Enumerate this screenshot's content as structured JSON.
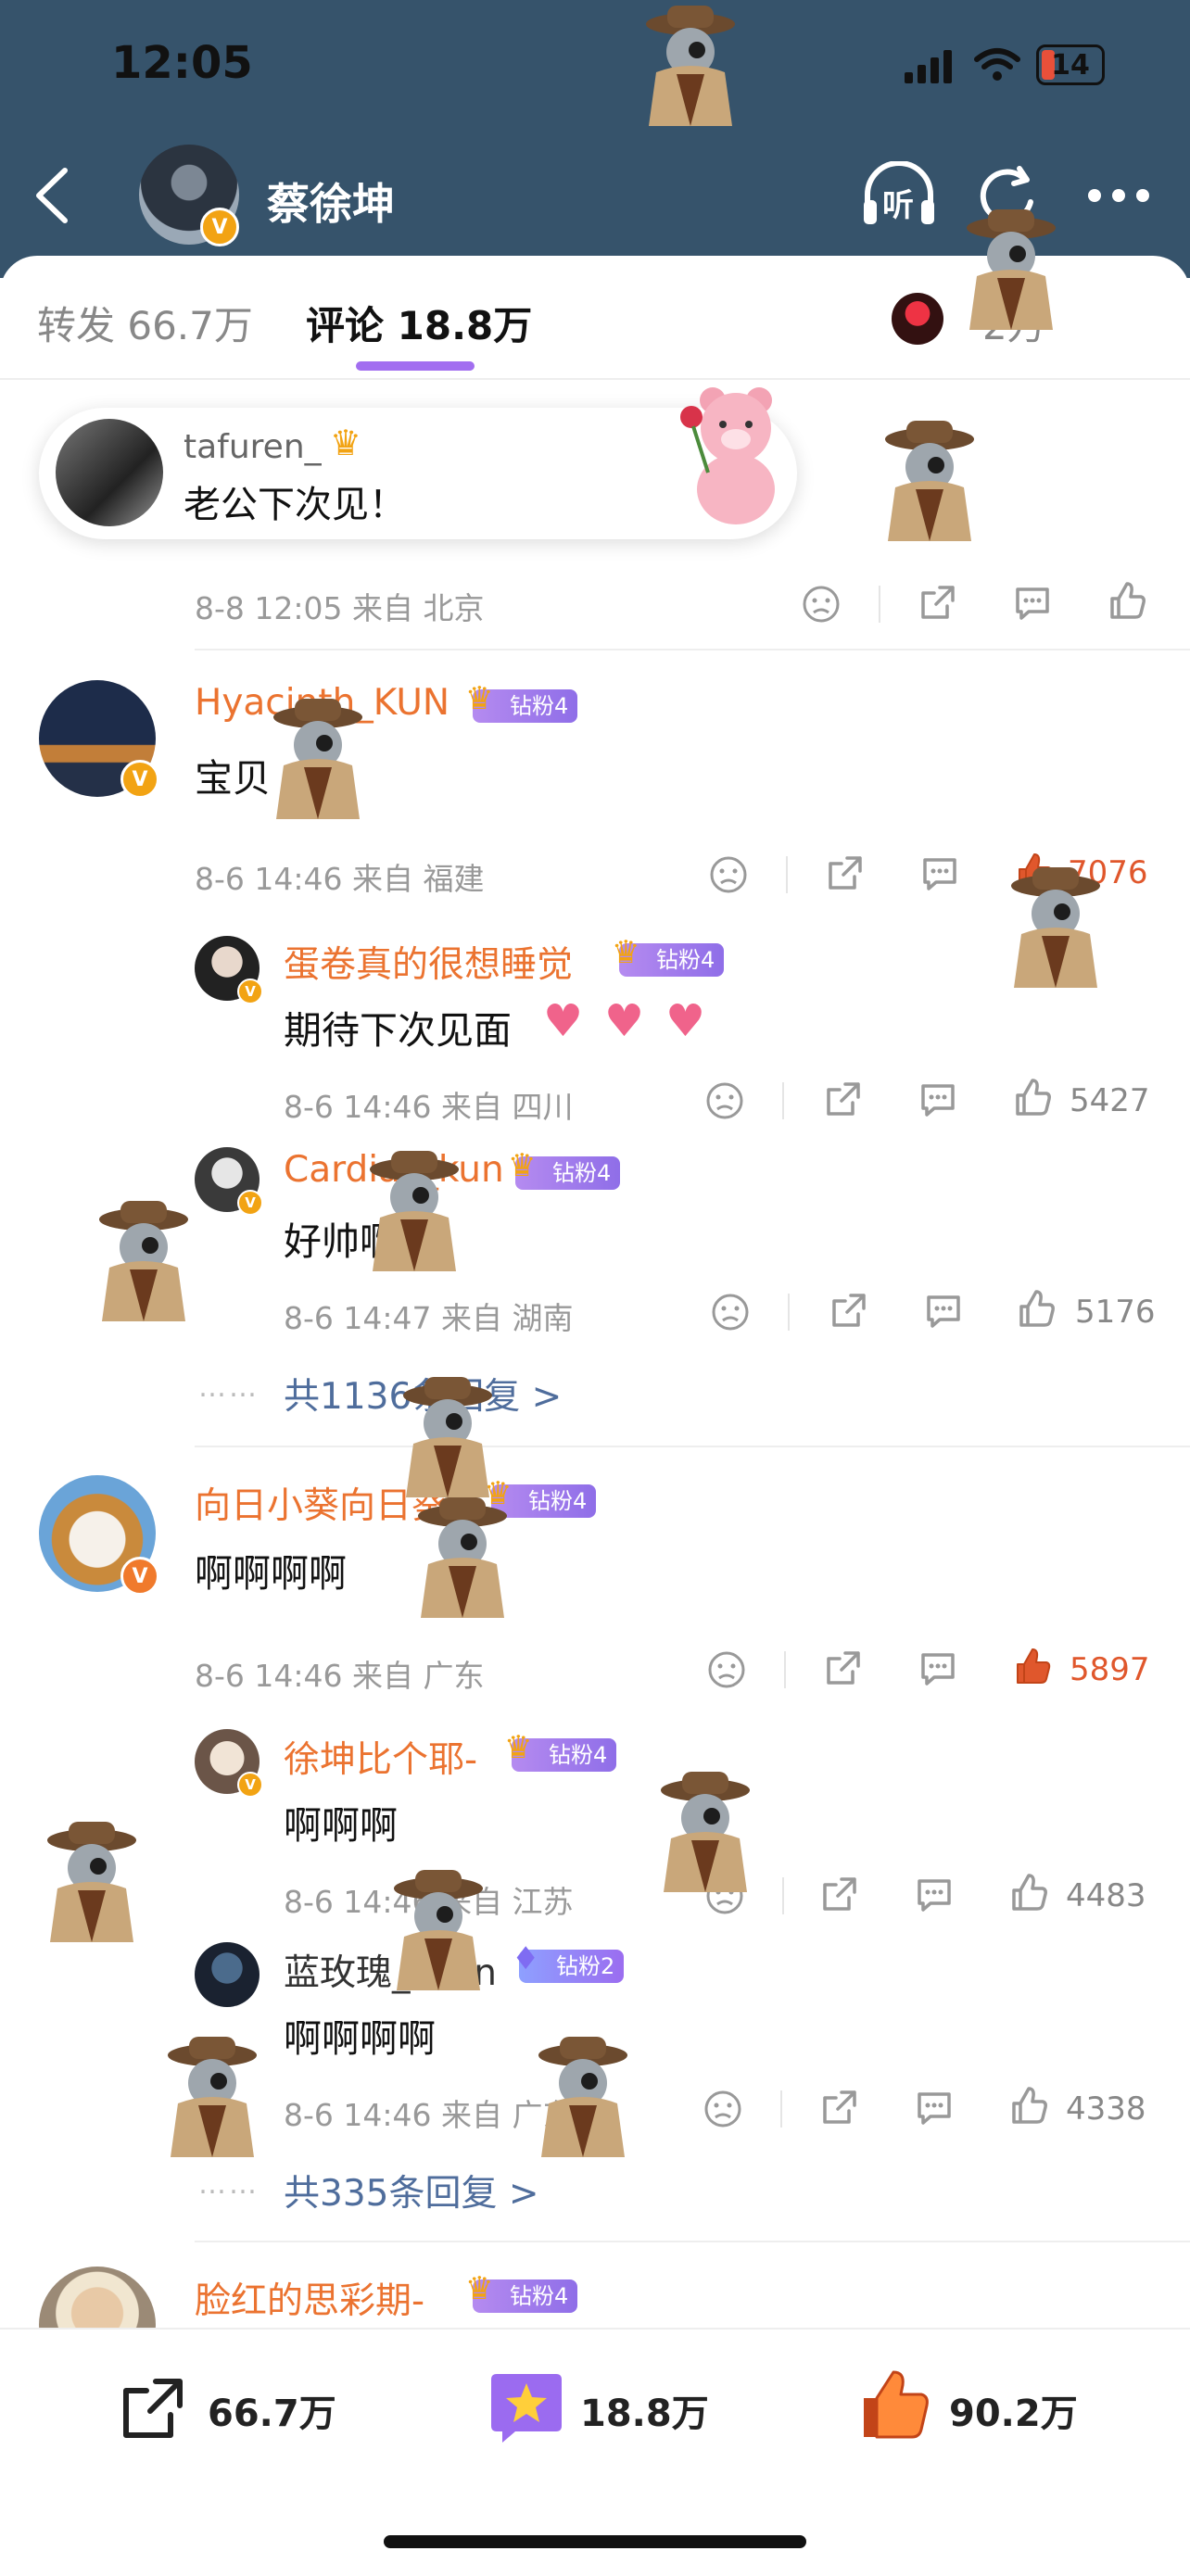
{
  "status_bar": {
    "time": "12:05",
    "battery": "14"
  },
  "nav": {
    "profile_name": "蔡徐坤",
    "listen_icon_label": "听"
  },
  "tabs": {
    "reposts": "转发 66.7万",
    "comments": "评论 18.8万",
    "likes": "2万"
  },
  "bubble": {
    "username": "tafuren_",
    "text": "老公下次见！"
  },
  "colors": {
    "header": "#36536b",
    "accent": "#a26ef0",
    "username": "#eb7330",
    "like_active": "#e0572c",
    "reply_link": "#4f6d9c"
  },
  "comments": [
    {
      "meta": "8-8 12:05 来自 北京"
    },
    {
      "username": "Hyacinth_KUN",
      "badge": "钻粉4",
      "text": "宝贝",
      "meta": "8-6 14:46 来自 福建",
      "likes": "7076",
      "replies": [
        {
          "username": "蛋卷真的很想睡觉",
          "badge": "钻粉4",
          "text": "期待下次见面",
          "meta": "8-6 14:46 来自 四川",
          "likes": "5427"
        },
        {
          "username": "Cardiac_kun",
          "badge": "钻粉4",
          "text": "好帅啊",
          "meta": "8-6 14:47 来自 湖南",
          "likes": "5176"
        }
      ],
      "reply_summary": "共1136条回复 >"
    },
    {
      "username": "向日小葵向日葵",
      "badge": "钻粉4",
      "text": "啊啊啊啊",
      "meta": "8-6 14:46 来自 广东",
      "likes": "5897",
      "replies": [
        {
          "username": "徐坤比个耶-",
          "badge": "钻粉4",
          "text": "啊啊啊",
          "meta": "8-6 14:46 来自 江苏",
          "likes": "4483"
        },
        {
          "username": "蓝玫瑰_kkun",
          "badge": "钻粉2",
          "text": "啊啊啊啊",
          "meta": "8-6 14:46 来自 广东",
          "likes": "4338"
        }
      ],
      "reply_summary": "共335条回复 >"
    },
    {
      "username": "脸红的思彩期-",
      "badge": "钻粉4"
    }
  ],
  "reply_dots": "……",
  "bottom_bar": {
    "reposts": "66.7万",
    "comments": "18.8万",
    "likes": "90.2万"
  }
}
